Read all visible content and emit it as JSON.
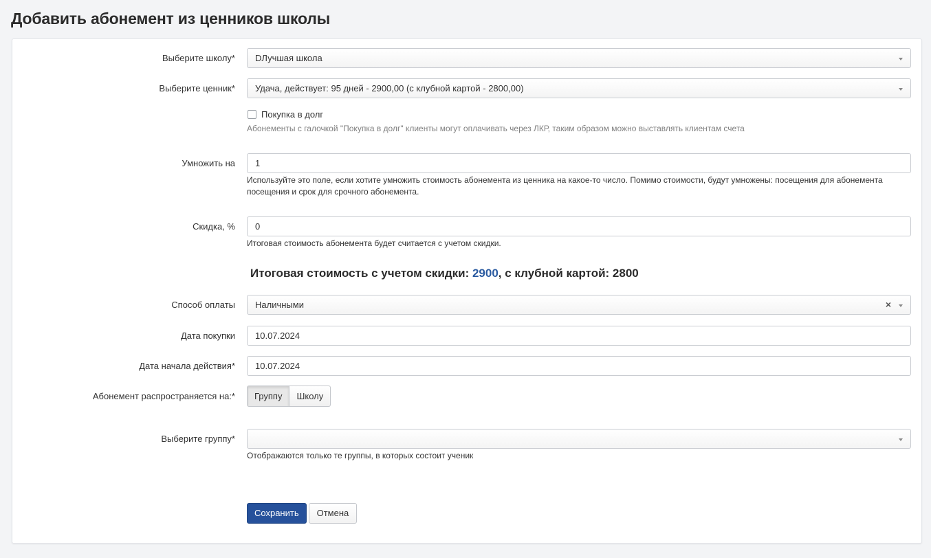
{
  "page_title": "Добавить абонемент из ценников школы",
  "form": {
    "school": {
      "label": "Выберите школу*",
      "value": "DЛучшая школа"
    },
    "price_list": {
      "label": "Выберите ценник*",
      "value": "Удача, действует: 95 дней - 2900,00 (с клубной картой - 2800,00)"
    },
    "debt_purchase": {
      "label": "Покупка в долг",
      "checked": false,
      "help": "Абонементы с галочкой \"Покупка в долг\" клиенты могут оплачивать через ЛКР, таким образом можно выставлять клиентам счета"
    },
    "multiply": {
      "label": "Умножить на",
      "value": "1",
      "help": "Используйте это поле, если хотите умножить стоимость абонемента из ценника на какое-то число. Помимо стоимости, будут умножены: посещения для абонемента посещения и срок для срочного абонемента."
    },
    "discount": {
      "label": "Скидка, %",
      "value": "0",
      "help": "Итоговая стоимость абонемента будет считается с учетом скидки."
    },
    "total": {
      "prefix": "Итоговая стоимость с учетом скидки: ",
      "amount": "2900",
      "suffix": ", с клубной картой: 2800"
    },
    "payment_method": {
      "label": "Способ оплаты",
      "value": "Наличными",
      "clear_glyph": "×"
    },
    "purchase_date": {
      "label": "Дата покупки",
      "value": "10.07.2024"
    },
    "start_date": {
      "label": "Дата начала действия*",
      "value": "10.07.2024"
    },
    "applies_to": {
      "label": "Абонемент распространяется на:*",
      "options": [
        "Группу",
        "Школу"
      ],
      "selected": "Группу"
    },
    "group": {
      "label": "Выберите группу*",
      "value": "",
      "help": "Отображаются только те группы, в которых состоит ученик"
    },
    "save_label": "Сохранить",
    "cancel_label": "Отмена"
  },
  "colors": {
    "primary": "#26519b",
    "accent_text": "#2a5aa0",
    "background": "#f3f4f6"
  }
}
